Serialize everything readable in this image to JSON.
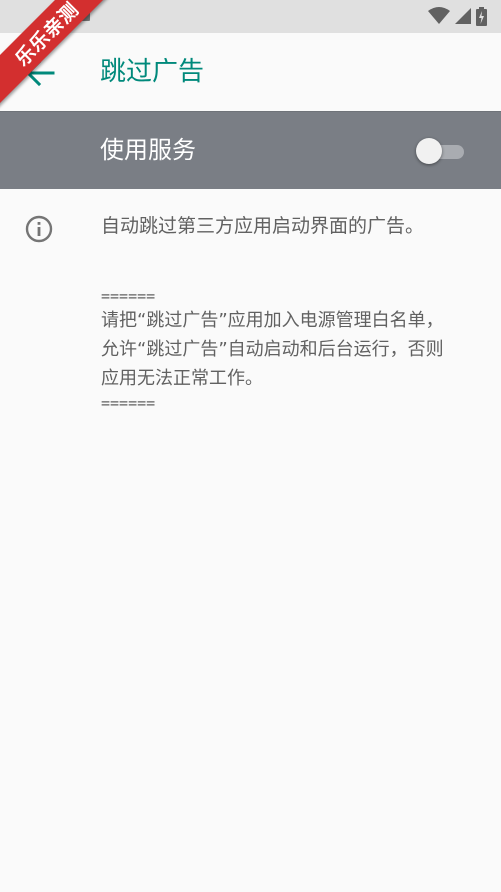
{
  "status_bar": {
    "icons": [
      "notification-icon",
      "wifi-icon",
      "signal-icon",
      "battery-charging-icon"
    ]
  },
  "watermark": {
    "text": "乐乐亲测"
  },
  "app_bar": {
    "back_icon": "arrow-back-icon",
    "title": "跳过广告"
  },
  "service": {
    "label": "使用服务",
    "enabled": false
  },
  "info": {
    "icon": "info-icon",
    "text": "自动跳过第三方应用启动界面的广告。"
  },
  "notice": {
    "separator_top": "======",
    "line1": "请把“跳过广告”应用加入电源管理白名单，",
    "line2": "允许“跳过广告”自动启动和后台运行，否则",
    "line3": "应用无法正常工作。",
    "separator_bottom": "======"
  },
  "colors": {
    "accent": "#00897b",
    "switch_bar_bg": "#7a7e85",
    "status_bar_bg": "#e0e0e0",
    "watermark_bg": "#d32f2f"
  }
}
